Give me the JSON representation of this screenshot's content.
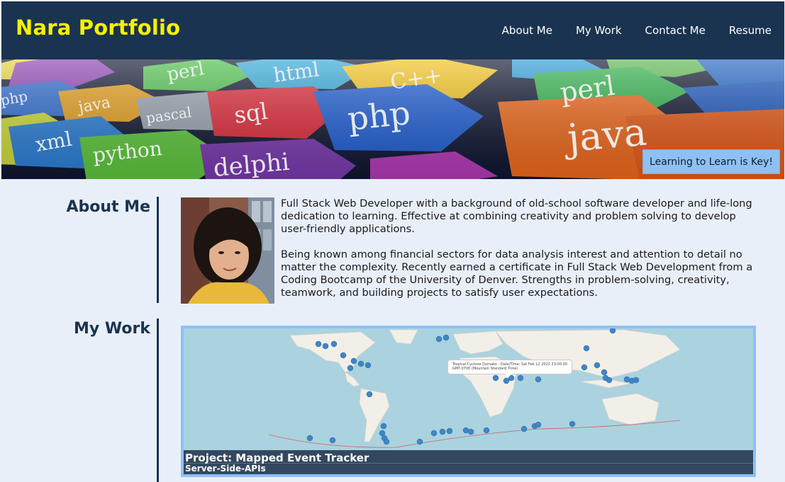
{
  "header": {
    "brand": "Nara Portfolio",
    "nav": [
      "About Me",
      "My Work",
      "Contact Me",
      "Resume"
    ]
  },
  "hero": {
    "tagline": "Learning to Learn is Key!",
    "tiles": [
      "perl",
      "html",
      "C++",
      "sql",
      "php",
      "perl",
      "java",
      "xml",
      "python",
      "delphi",
      "pascal",
      "java",
      "php"
    ]
  },
  "about": {
    "title": "About Me",
    "paragraphs": [
      "Full Stack Web Developer with a background of old-school software developer and life-long dedication to learning. Effective at combining creativity and problem solving to develop user-friendly applications.",
      "Being known among financial sectors for data analysis interest and attention to detail no matter the complexity. Recently earned a certificate in Full Stack Web Development from a Coding Bootcamp of the University of Denver. Strengths in problem-solving, creativity, teamwork, and building projects to satisfy user expectations."
    ]
  },
  "work": {
    "title": "My Work",
    "project_title": "Project: Mapped Event Tracker",
    "project_subtitle": "Server-Side-APIs",
    "map_popup": "Tropical Cyclone Dumako - Date/Time: Sat Feb 12 2022 23:00:00 GMT-0700 (Mountain Standard Time)"
  },
  "colors": {
    "header_bg": "#1a3350",
    "brand": "#f6f200",
    "page_bg": "#e8eff8",
    "accent": "#8ec0f8",
    "section_title": "#1b3350"
  }
}
